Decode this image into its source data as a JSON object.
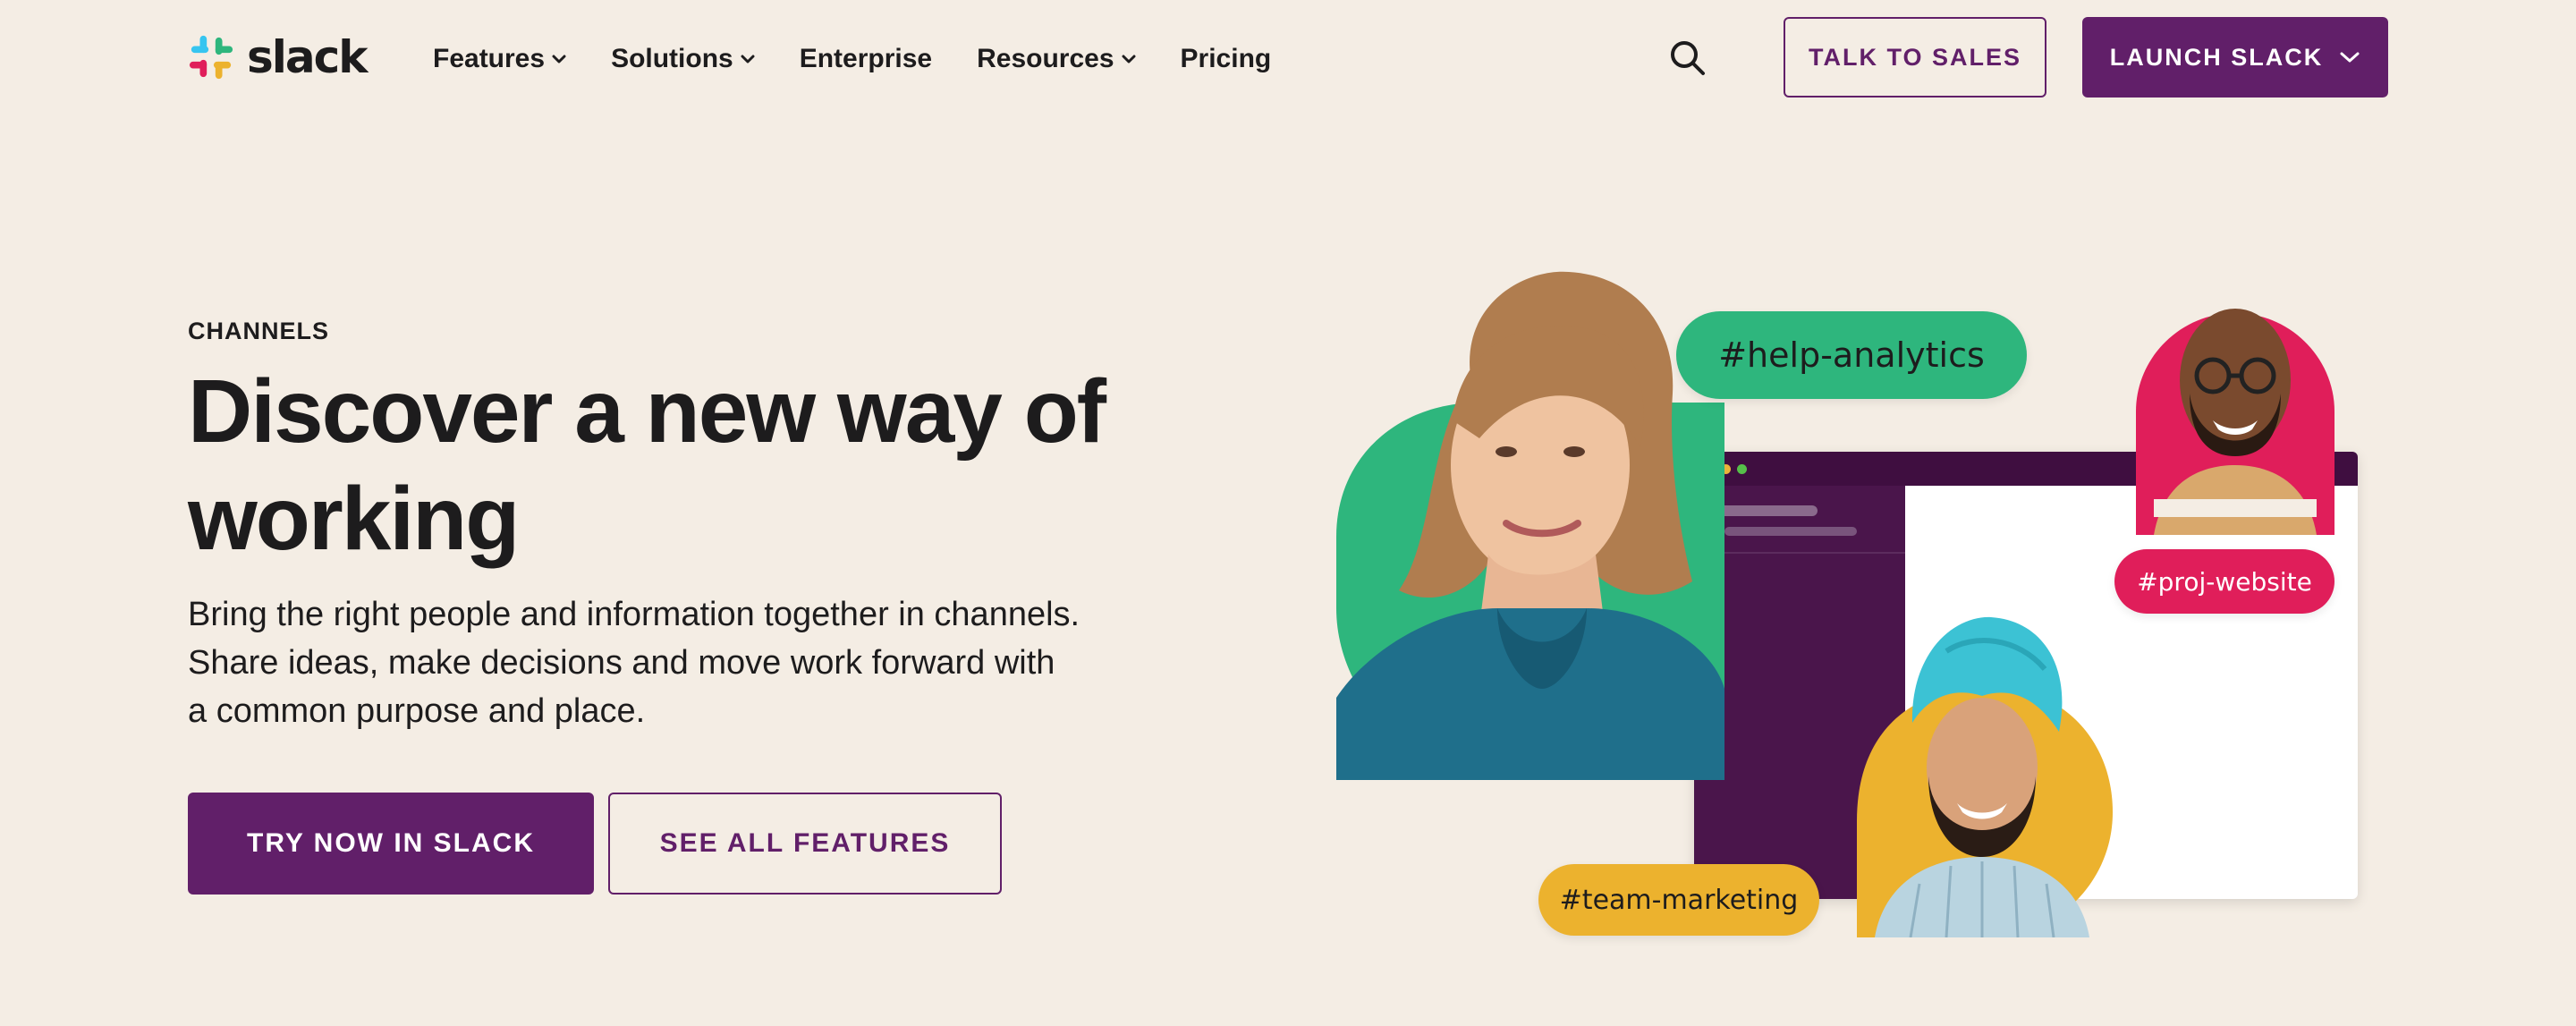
{
  "brand": {
    "name": "slack",
    "logo_colors": [
      "#36c5f0",
      "#2eb67d",
      "#ecb22e",
      "#e01e5a"
    ]
  },
  "nav": {
    "links": [
      {
        "label": "Features",
        "has_dropdown": true
      },
      {
        "label": "Solutions",
        "has_dropdown": true
      },
      {
        "label": "Enterprise",
        "has_dropdown": false
      },
      {
        "label": "Resources",
        "has_dropdown": true
      },
      {
        "label": "Pricing",
        "has_dropdown": false
      }
    ],
    "search_icon": "search-icon",
    "talk_to_sales": "TALK TO SALES",
    "launch_slack": "LAUNCH SLACK"
  },
  "hero": {
    "eyebrow": "CHANNELS",
    "headline": "Discover a new way of working",
    "body": "Bring the right people and information together in channels. Share ideas, make decisions and move work forward with a common purpose and place.",
    "cta_primary": "TRY NOW IN SLACK",
    "cta_secondary": "SEE ALL FEATURES"
  },
  "illustration": {
    "channel_tags": [
      {
        "label": "#help-analytics",
        "color": "#2eb67d"
      },
      {
        "label": "#proj-website",
        "color": "#e01e5a"
      },
      {
        "label": "#team-marketing",
        "color": "#ecb22e"
      }
    ]
  },
  "colors": {
    "background": "#f4ede4",
    "aubergine": "#611f69",
    "text": "#1d1c1d"
  }
}
